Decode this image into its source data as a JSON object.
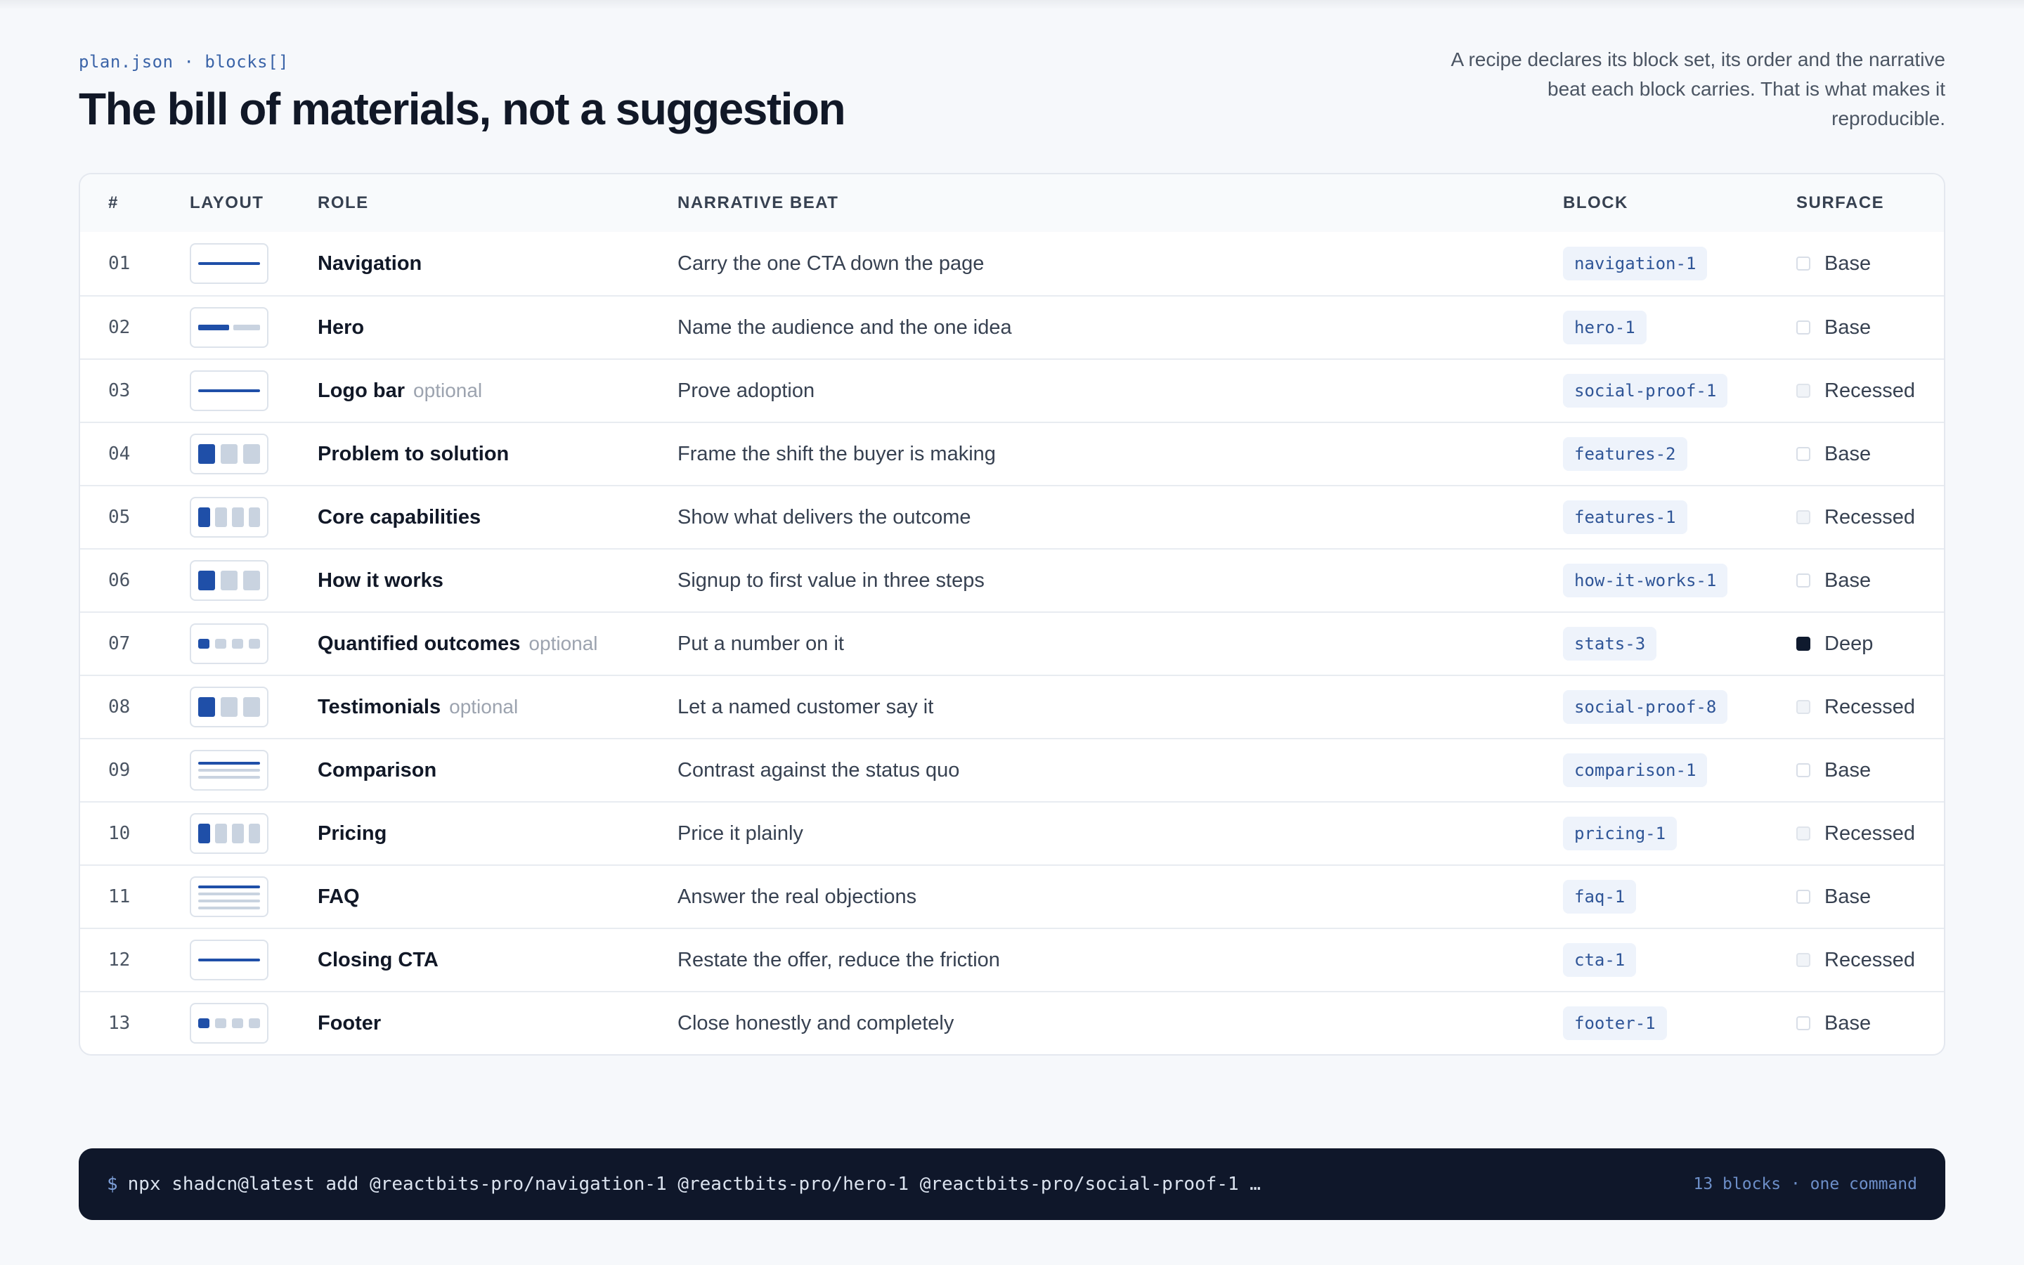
{
  "header": {
    "eyebrow": "plan.json · blocks[]",
    "title": "The bill of materials, not a suggestion",
    "intro": "A recipe declares its block set, its order and the narrative beat each block carries. That is what makes it reproducible."
  },
  "table": {
    "columns": [
      "#",
      "LAYOUT",
      "ROLE",
      "NARRATIVE BEAT",
      "BLOCK",
      "SURFACE"
    ],
    "rows": [
      {
        "num": "01",
        "layout": "line",
        "role": "Navigation",
        "optional": "",
        "beat": "Carry the one CTA down the page",
        "block": "navigation-1",
        "surface": "Base",
        "surface_kind": "base"
      },
      {
        "num": "02",
        "layout": "split",
        "role": "Hero",
        "optional": "",
        "beat": "Name the audience and the one idea",
        "block": "hero-1",
        "surface": "Base",
        "surface_kind": "base"
      },
      {
        "num": "03",
        "layout": "line",
        "role": "Logo bar",
        "optional": "optional",
        "beat": "Prove adoption",
        "block": "social-proof-1",
        "surface": "Recessed",
        "surface_kind": "recessed"
      },
      {
        "num": "04",
        "layout": "grid3",
        "role": "Problem to solution",
        "optional": "",
        "beat": "Frame the shift the buyer is making",
        "block": "features-2",
        "surface": "Base",
        "surface_kind": "base"
      },
      {
        "num": "05",
        "layout": "grid4",
        "role": "Core capabilities",
        "optional": "",
        "beat": "Show what delivers the outcome",
        "block": "features-1",
        "surface": "Recessed",
        "surface_kind": "recessed"
      },
      {
        "num": "06",
        "layout": "grid3",
        "role": "How it works",
        "optional": "",
        "beat": "Signup to first value in three steps",
        "block": "how-it-works-1",
        "surface": "Base",
        "surface_kind": "base"
      },
      {
        "num": "07",
        "layout": "dots4",
        "role": "Quantified outcomes",
        "optional": "optional",
        "beat": "Put a number on it",
        "block": "stats-3",
        "surface": "Deep",
        "surface_kind": "deep"
      },
      {
        "num": "08",
        "layout": "grid3",
        "role": "Testimonials",
        "optional": "optional",
        "beat": "Let a named customer say it",
        "block": "social-proof-8",
        "surface": "Recessed",
        "surface_kind": "recessed"
      },
      {
        "num": "09",
        "layout": "lines3",
        "role": "Comparison",
        "optional": "",
        "beat": "Contrast against the status quo",
        "block": "comparison-1",
        "surface": "Base",
        "surface_kind": "base"
      },
      {
        "num": "10",
        "layout": "grid4",
        "role": "Pricing",
        "optional": "",
        "beat": "Price it plainly",
        "block": "pricing-1",
        "surface": "Recessed",
        "surface_kind": "recessed"
      },
      {
        "num": "11",
        "layout": "lines4",
        "role": "FAQ",
        "optional": "",
        "beat": "Answer the real objections",
        "block": "faq-1",
        "surface": "Base",
        "surface_kind": "base"
      },
      {
        "num": "12",
        "layout": "line",
        "role": "Closing CTA",
        "optional": "",
        "beat": "Restate the offer, reduce the friction",
        "block": "cta-1",
        "surface": "Recessed",
        "surface_kind": "recessed"
      },
      {
        "num": "13",
        "layout": "dots4",
        "role": "Footer",
        "optional": "",
        "beat": "Close honestly and completely",
        "block": "footer-1",
        "surface": "Base",
        "surface_kind": "base"
      }
    ]
  },
  "command": {
    "prompt": "$",
    "text": "npx shadcn@latest add @reactbits-pro/navigation-1 @reactbits-pro/hero-1 @reactbits-pro/social-proof-1 …",
    "meta": "13 blocks · one command"
  },
  "colors": {
    "accent": "#1f4fa8",
    "muted_block": "#c9d3e0",
    "deep": "#0f1a2e"
  }
}
